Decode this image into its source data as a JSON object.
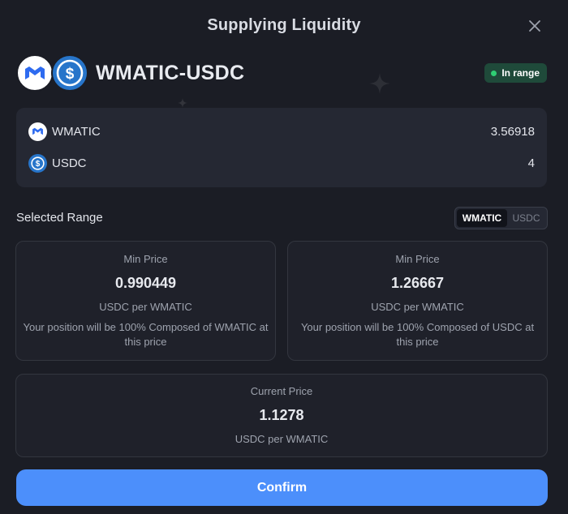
{
  "modal": {
    "title": "Supplying Liquidity",
    "close_icon": "close-icon"
  },
  "pair": {
    "name": "WMATIC-USDC",
    "status": "In range",
    "status_color": "#2fcf74",
    "token0_icon": "polygon-logo-icon",
    "token1_icon": "usdc-logo-icon"
  },
  "amounts": [
    {
      "symbol": "WMATIC",
      "value": "3.56918",
      "icon": "polygon-logo-icon"
    },
    {
      "symbol": "USDC",
      "value": "4",
      "icon": "usdc-logo-icon"
    }
  ],
  "range": {
    "label": "Selected Range",
    "toggle": [
      "WMATIC",
      "USDC"
    ],
    "toggle_selected": "WMATIC",
    "min": {
      "label": "Min Price",
      "value": "0.990449",
      "unit": "USDC per WMATIC",
      "desc": "Your position will be 100% Composed of WMATIC at this price"
    },
    "max": {
      "label": "Min Price",
      "value": "1.26667",
      "unit": "USDC per WMATIC",
      "desc": "Your position will be 100% Composed of USDC at this price"
    },
    "current": {
      "label": "Current Price",
      "value": "1.1278",
      "unit": "USDC per WMATIC"
    }
  },
  "confirm_label": "Confirm",
  "accent_color": "#4c8ffb"
}
